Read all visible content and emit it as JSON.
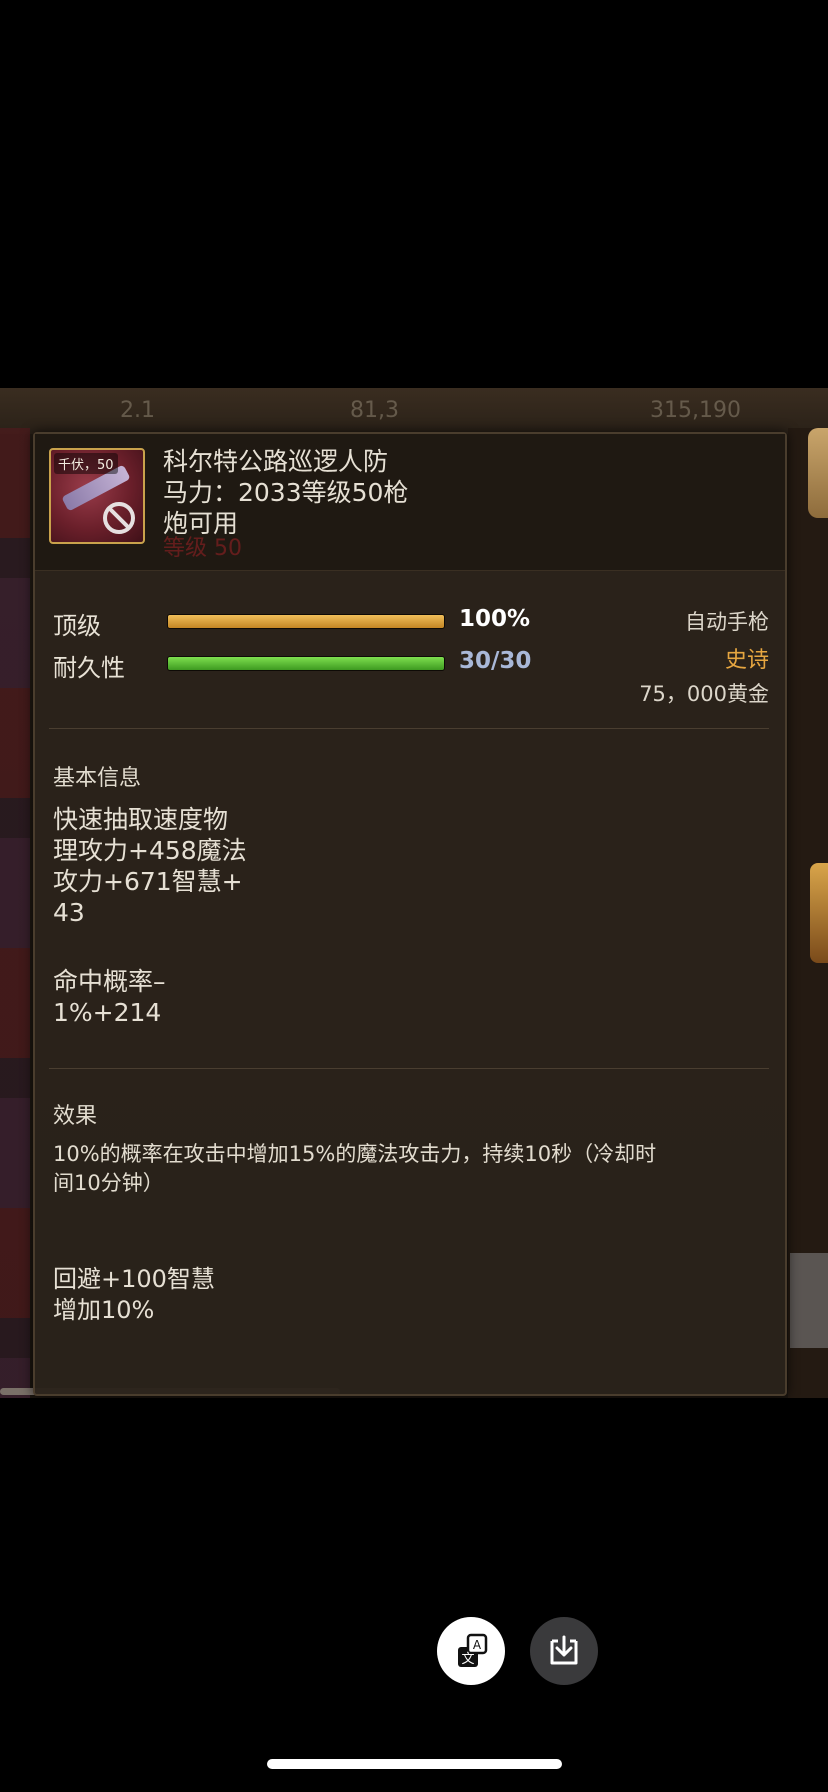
{
  "item": {
    "icon_badge": "千伏，50",
    "name_lines": [
      "科尔特公路巡逻人防",
      "马力：2033等级50枪",
      "炮可用"
    ],
    "req_faded": "等级 50"
  },
  "stats": {
    "top_label": "顶级",
    "top_value": "100%",
    "top_fill": 1.0,
    "durability_label": "耐久性",
    "durability_value": "30/30",
    "durability_fill": 1.0
  },
  "meta": {
    "type": "自动手枪",
    "rarity": "史诗",
    "price": "75，000黄金"
  },
  "basic": {
    "title": "基本信息",
    "lines": [
      "快速抽取速度物",
      "理攻力+458魔法",
      "攻力+671智慧+",
      "43"
    ],
    "lines2": [
      "命中概率–",
      "1%+214"
    ]
  },
  "effect": {
    "title": "效果",
    "lines": [
      "10%的概率在攻击中增加15%的魔法攻击力，持续10秒（冷却时",
      "间10分钟）"
    ],
    "lines2": [
      "回避+100智慧",
      "增加10%"
    ]
  },
  "colors": {
    "gold_bar": "#e0a53c",
    "green_bar": "#5fc838",
    "rarity": "#e6a640",
    "value_blue": "#a9b8d8"
  },
  "icons": [
    "translate-icon",
    "download-icon",
    "no-entry-icon"
  ]
}
